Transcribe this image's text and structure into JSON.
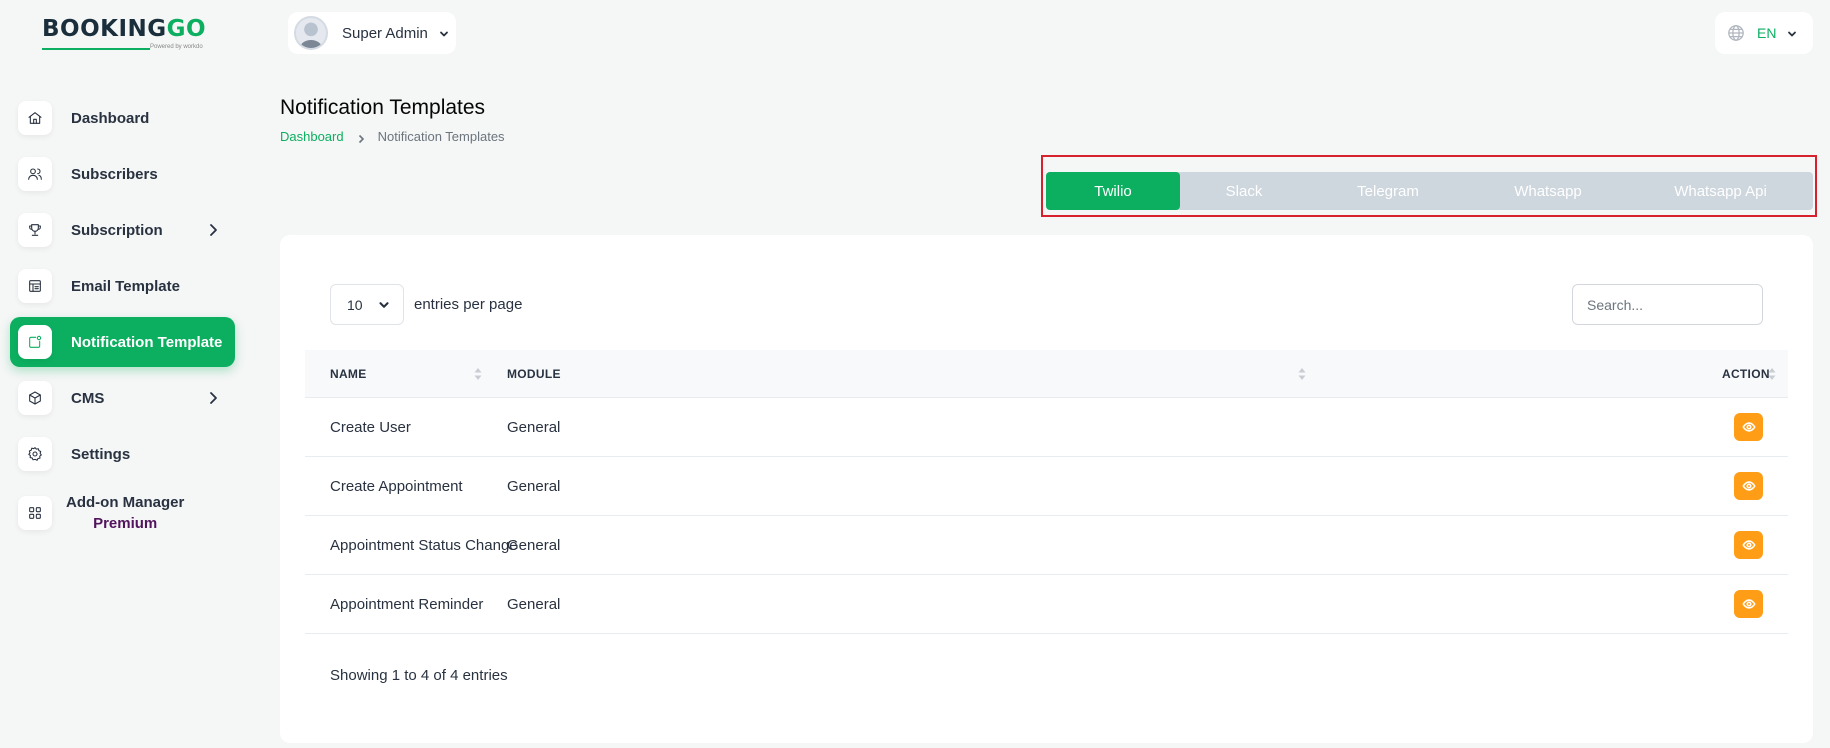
{
  "brand": {
    "name_part1": "BOOKING",
    "name_part2": "GO",
    "powered": "Powered by workdo"
  },
  "sidebar": {
    "items": [
      {
        "label": "Dashboard"
      },
      {
        "label": "Subscribers"
      },
      {
        "label": "Subscription"
      },
      {
        "label": "Email Template"
      },
      {
        "label": "Notification Template"
      },
      {
        "label": "CMS"
      },
      {
        "label": "Settings"
      },
      {
        "label": "Add-on Manager",
        "badge": "Premium"
      }
    ]
  },
  "topbar": {
    "user_name": "Super Admin",
    "language": "EN"
  },
  "header": {
    "title": "Notification Templates",
    "breadcrumb": {
      "home": "Dashboard",
      "current": "Notification Templates"
    }
  },
  "tabs": [
    {
      "label": "Twilio",
      "active": true
    },
    {
      "label": "Slack",
      "active": false
    },
    {
      "label": "Telegram",
      "active": false
    },
    {
      "label": "Whatsapp",
      "active": false
    },
    {
      "label": "Whatsapp Api",
      "active": false
    }
  ],
  "table": {
    "page_size": "10",
    "page_size_label": "entries per page",
    "search_placeholder": "Search...",
    "columns": {
      "name": "NAME",
      "module": "MODULE",
      "action": "ACTION"
    },
    "rows": [
      {
        "name": "Create User",
        "module": "General"
      },
      {
        "name": "Create Appointment",
        "module": "General"
      },
      {
        "name": "Appointment Status Change",
        "module": "General"
      },
      {
        "name": "Appointment Reminder",
        "module": "General"
      }
    ],
    "footer": "Showing 1 to 4 of 4 entries"
  },
  "colors": {
    "primary": "#0caf60",
    "action": "#ff9e16",
    "highlight_border": "#d7222e",
    "tab_inactive": "#ced6de"
  }
}
